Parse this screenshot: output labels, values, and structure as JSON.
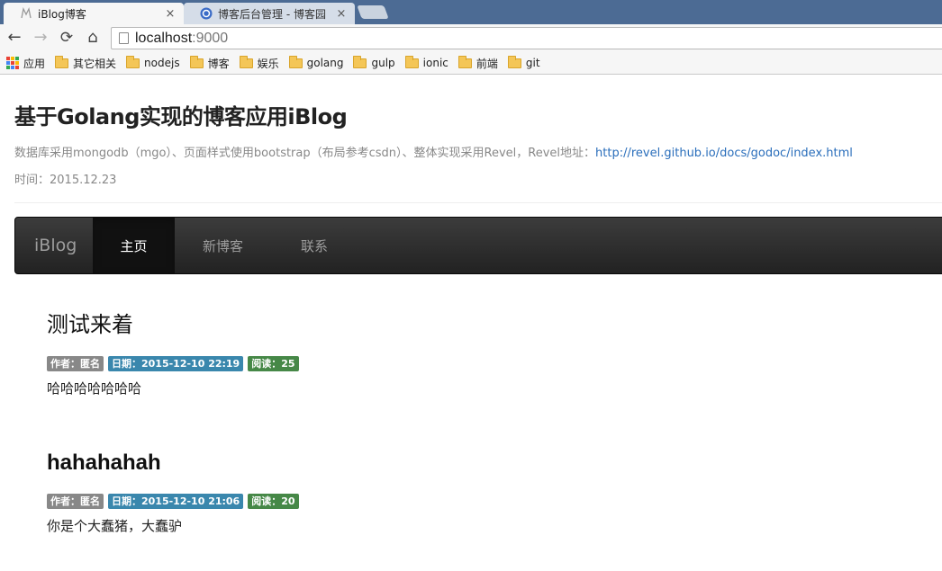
{
  "browser": {
    "tabs": [
      {
        "title": "iBlog博客",
        "close": "×"
      },
      {
        "title": "博客后台管理 - 博客园",
        "close": "×"
      }
    ],
    "toolbar": {
      "back": "←",
      "forward": "→",
      "reload": "⟳",
      "home": "⌂"
    },
    "address": {
      "host": "localhost",
      "port": ":9000"
    },
    "bookmarks": {
      "apps_label": "应用",
      "folders": [
        "其它相关",
        "nodejs",
        "博客",
        "娱乐",
        "golang",
        "gulp",
        "ionic",
        "前端",
        "git"
      ]
    }
  },
  "site": {
    "title_prefix": "基于",
    "title_bold1": "Golang",
    "title_mid": "实现的博客应用",
    "title_bold2": "iBlog",
    "description": "数据库采用mongodb（mgo）、页面样式使用bootstrap（布局参考csdn）、整体实现采用Revel，Revel地址：",
    "link": "http://revel.github.io/docs/godoc/index.html",
    "time": "时间：2015.12.23"
  },
  "navbar": {
    "brand": "iBlog",
    "items": [
      "主页",
      "新博客",
      "联系"
    ]
  },
  "posts": [
    {
      "title": "测试来着",
      "author": "作者：匿名",
      "date": "日期：2015-12-10 22:19",
      "reads": "阅读：25",
      "body": "哈哈哈哈哈哈哈"
    },
    {
      "title": "hahahahah",
      "author": "作者：匿名",
      "date": "日期：2015-12-10 21:06",
      "reads": "阅读：20",
      "body": "你是个大蠢猪，大蠢驴"
    }
  ],
  "colors": {
    "tabstrip": "#4c6b94",
    "navbar": "#222222",
    "label_grey": "#888888",
    "label_blue": "#3a87ad",
    "label_green": "#468847",
    "link": "#2a6ebb"
  }
}
